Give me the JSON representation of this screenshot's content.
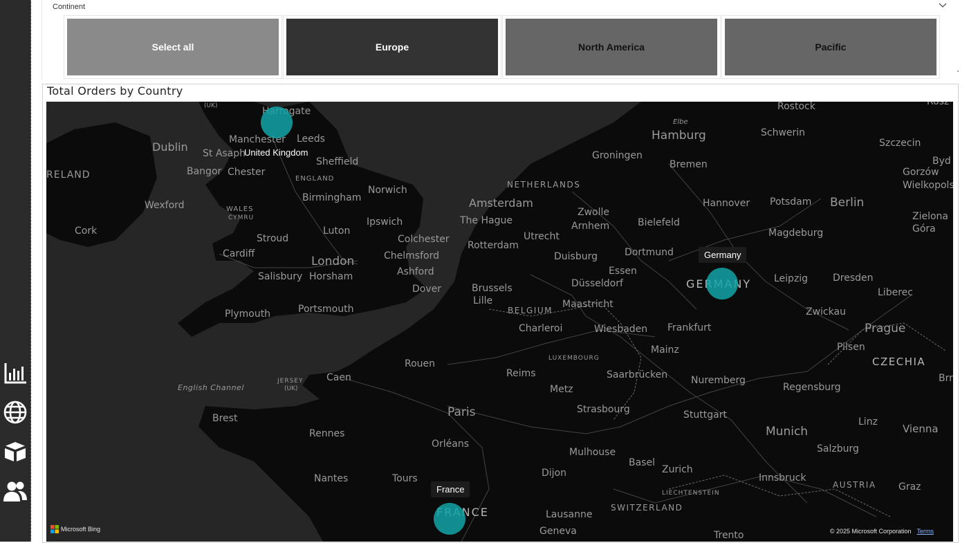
{
  "slicer": {
    "title": "Continent",
    "tiles": [
      {
        "label": "Select all",
        "bg": "#8a8a8a",
        "fg": "#ffffff"
      },
      {
        "label": "Europe",
        "bg": "#333333",
        "fg": "#ffffff"
      },
      {
        "label": "North America",
        "bg": "#666666",
        "fg": "#111111"
      },
      {
        "label": "Pacific",
        "bg": "#666666",
        "fg": "#111111"
      }
    ]
  },
  "map": {
    "title": "Total Orders by Country",
    "bubble_color": "#13a5a8",
    "bubbles": [
      {
        "country": "United Kingdom"
      },
      {
        "country": "Germany"
      },
      {
        "country": "France"
      }
    ],
    "places": {
      "rostock": "Rostock",
      "harrogate": "Harrogate",
      "uk": "(UK)",
      "dublin": "Dublin",
      "manchester": "Manchester",
      "leeds": "Leeds",
      "st_asaph": "St Asaph",
      "sheffield": "Sheffield",
      "bangor": "Bangor",
      "chester": "Chester",
      "ireland": "RELAND",
      "england": "ENGLAND",
      "norwich": "Norwich",
      "wexford": "Wexford",
      "birmingham": "Birmingham",
      "wales": "WALES",
      "cymru": "CYMRU",
      "cork": "Cork",
      "luton": "Luton",
      "ipswich": "Ipswich",
      "stroud": "Stroud",
      "colchester": "Colchester",
      "cardiff": "Cardiff",
      "chelmsford": "Chelmsford",
      "london": "London",
      "ashford": "Ashford",
      "salisbury": "Salisbury",
      "horsham": "Horsham",
      "dover": "Dover",
      "portsmouth": "Portsmouth",
      "plymouth": "Plymouth",
      "english_channel": "English Channel",
      "jersey": "JERSEY",
      "jersey_uk": "(UK)",
      "brest": "Brest",
      "rennes": "Rennes",
      "nantes": "Nantes",
      "tours": "Tours",
      "caen": "Caen",
      "rouen": "Rouen",
      "paris": "Paris",
      "orleans": "Orléans",
      "reims": "Reims",
      "netherlands": "NETHERLANDS",
      "amsterdam": "Amsterdam",
      "the_hague": "The Hague",
      "rotterdam": "Rotterdam",
      "utrecht": "Utrecht",
      "groningen": "Groningen",
      "zwolle": "Zwolle",
      "arnhem": "Arnhem",
      "brussels": "Brussels",
      "lille": "Lille",
      "belgium": "BELGIUM",
      "charleroi": "Charleroi",
      "maastricht": "Maastricht",
      "luxembourg": "LUXEMBOURG",
      "metz": "Metz",
      "strasbourg": "Strasbourg",
      "mulhouse": "Mulhouse",
      "dijon": "Dijon",
      "lausanne": "Lausanne",
      "geneva": "Geneva",
      "basel": "Basel",
      "zurich": "Zurich",
      "liechtenstein": "LIECHTENSTEIN",
      "switzerland": "SWITZERLAND",
      "france": "FRANCE",
      "duisburg": "Duisburg",
      "essen": "Essen",
      "dortmund": "Dortmund",
      "dusseldorf": "Düsseldorf",
      "wiesbaden": "Wiesbaden",
      "frankfurt": "Frankfurt",
      "mainz": "Mainz",
      "saarbrucken": "Saarbrücken",
      "stuttgart": "Stuttgart",
      "nuremberg": "Nuremberg",
      "munich": "Munich",
      "regensburg": "Regensburg",
      "innsbruck": "Innsbruck",
      "germany": "GERMANY",
      "bielefeld": "Bielefeld",
      "hannover": "Hannover",
      "bremen": "Bremen",
      "hamburg": "Hamburg",
      "elbe": "Elbe",
      "schwerin": "Schwerin",
      "potsdam": "Potsdam",
      "berlin": "Berlin",
      "magdeburg": "Magdeburg",
      "leipzig": "Leipzig",
      "dresden": "Dresden",
      "liberec": "Liberec",
      "zwickau": "Zwickau",
      "prague": "Prague",
      "pilsen": "Pilsen",
      "czechia": "CZECHIA",
      "linz": "Linz",
      "vienna": "Vienna",
      "salzburg": "Salzburg",
      "austria": "AUSTRIA",
      "graz": "Graz",
      "szczecin": "Szczecin",
      "gorzow": "Gorzów",
      "wielkopolski": "Wielkopolski",
      "zielona": "Zielona",
      "gora": "Góra",
      "bydg": "Byd",
      "brn": "Brn",
      "trento": "Trento",
      "roszc": "Rosz"
    },
    "attribution": {
      "bing": "Microsoft Bing",
      "copyright": "© 2025 Microsoft Corporation",
      "terms": "Terms"
    }
  }
}
